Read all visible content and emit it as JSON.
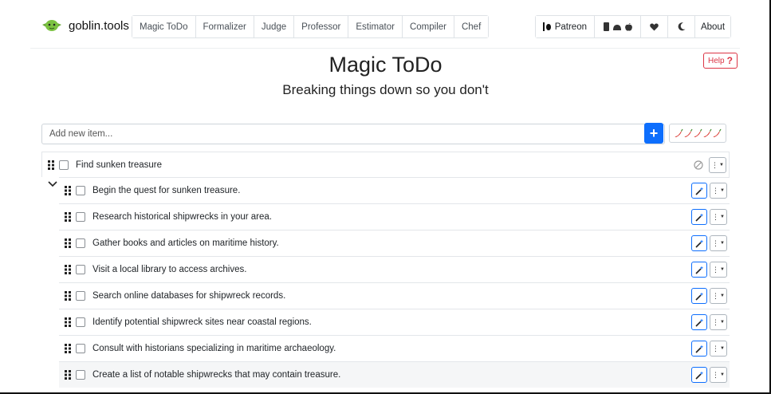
{
  "brand": {
    "name": "goblin.tools",
    "icon": "goblin-logo-icon"
  },
  "nav": {
    "tools": [
      "Magic ToDo",
      "Formalizer",
      "Judge",
      "Professor",
      "Estimator",
      "Compiler",
      "Chef"
    ],
    "patreon_label": "Patreon",
    "apps_icons": [
      "android-icon",
      "linux-icon",
      "apple-icon"
    ],
    "heart_icon": "heart-icon",
    "theme_icon": "moon-icon",
    "about_label": "About"
  },
  "header": {
    "title": "Magic ToDo",
    "subtitle": "Breaking things down so you don't",
    "help_label": "Help",
    "help_mark": "?"
  },
  "add_item": {
    "placeholder": "Add new item...",
    "add_button": "+",
    "spiciness_level": 5,
    "spiciness_icon": "chili-pepper-icon"
  },
  "colors": {
    "accent": "#0d6efd",
    "help": "#dc3545",
    "goblin_green": "#7cc242",
    "chili": "#d7261e"
  },
  "tasks": {
    "parent": "Find sunken treasure",
    "subtasks": [
      "Begin the quest for sunken treasure.",
      "Research historical shipwrecks in your area.",
      "Gather books and articles on maritime history.",
      "Visit a local library to access archives.",
      "Search online databases for shipwreck records.",
      "Identify potential shipwreck sites near coastal regions.",
      "Consult with historians specializing in maritime archaeology.",
      "Create a list of notable shipwrecks that may contain treasure."
    ]
  }
}
